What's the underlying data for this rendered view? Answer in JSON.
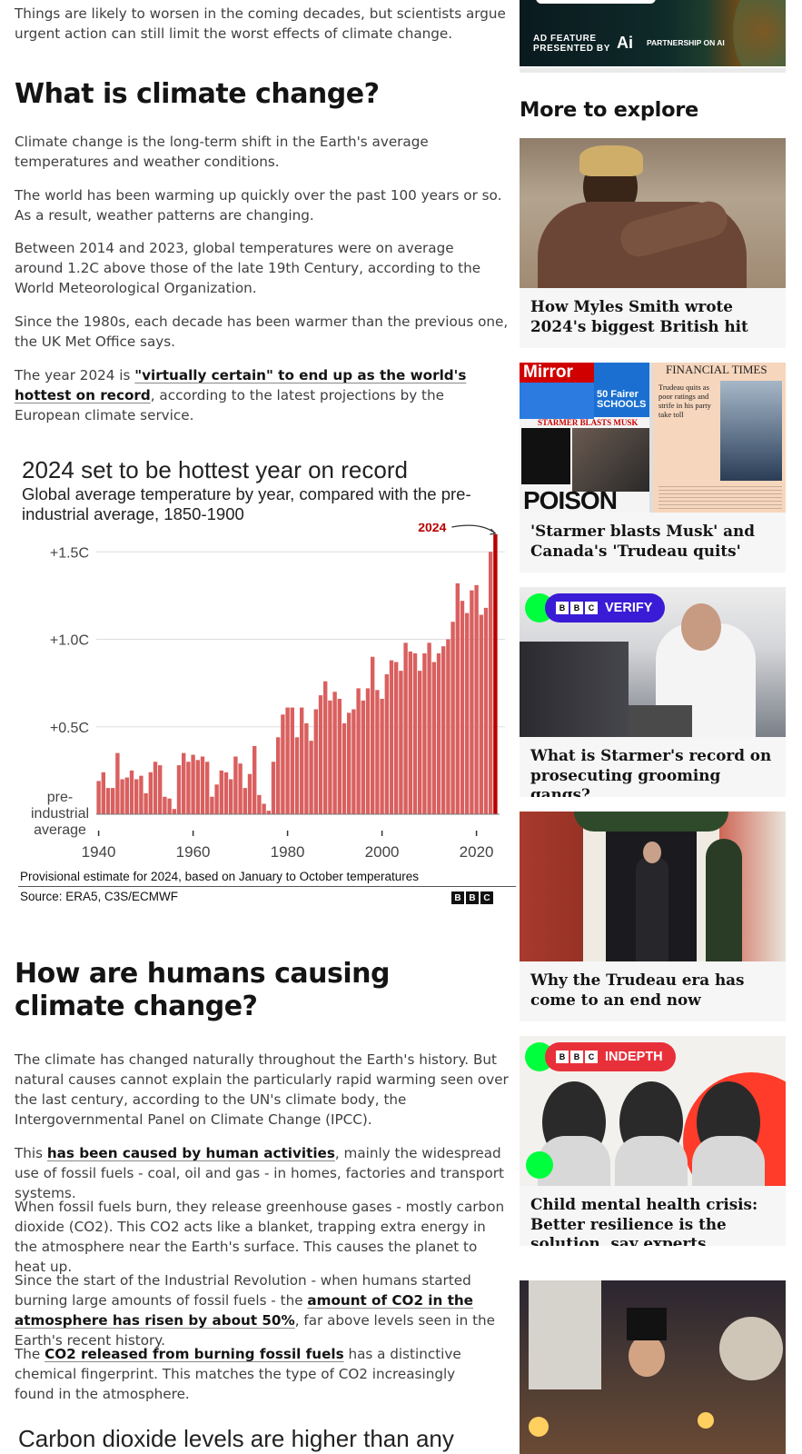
{
  "article": {
    "intro_tail": "Things are likely to worsen in the coming decades, but scientists argue urgent action can still limit the worst effects of climate change.",
    "section1": {
      "heading": "What is climate change?",
      "p1": "Climate change is the long-term shift in the Earth's average temperatures and weather conditions.",
      "p2": "The world has been warming up quickly over the past 100 years or so. As a result, weather patterns are changing.",
      "p3": "Between 2014 and 2023, global temperatures were on average around 1.2C above those of the late 19th Century, according to the World Meteorological Organization.",
      "p4": "Since the 1980s, each decade has been warmer than the previous one, the UK Met Office says.",
      "p5_pre": "The year 2024 is ",
      "p5_link": "\"virtually certain\" to end up as the world's hottest on record",
      "p5_post": ", according to the latest projections by the European climate service."
    },
    "section2": {
      "heading": "How are humans causing climate change?",
      "p1": "The climate has changed naturally throughout the Earth's history. But natural causes cannot explain the particularly rapid warming seen over the last century, according to the UN's climate body, the Intergovernmental Panel on Climate Change (IPCC).",
      "p2_pre": "This ",
      "p2_link": "has been caused by human activities",
      "p2_post": ", mainly the widespread use of fossil fuels - coal, oil and gas - in homes, factories and transport systems.",
      "p3": "When fossil fuels burn, they release greenhouse gases - mostly carbon dioxide (CO2). This CO2 acts like a blanket, trapping extra energy in the atmosphere near the Earth's surface. This causes the planet to heat up.",
      "p4_pre": "Since the start of the Industrial Revolution - when humans started burning large amounts of fossil fuels - the ",
      "p4_link": "amount of CO2 in the atmosphere has risen by about 50%",
      "p4_post": ", far above levels seen in the Earth's recent history.",
      "p5_pre": "The ",
      "p5_link": "CO2 released from burning fossil fuels",
      "p5_post": " has a distinctive chemical fingerprint. This matches the type of CO2 increasingly found in the atmosphere."
    },
    "next_chart_title": "Carbon dioxide levels are higher than any"
  },
  "chart_data": {
    "type": "bar",
    "title": "2024 set to be hottest year on record",
    "subtitle": "Global average temperature by year, compared with the pre-industrial average, 1850-1900",
    "xlabel": "",
    "ylabel": "",
    "x_range": [
      1940,
      2024
    ],
    "x_ticks": [
      "1940",
      "1960",
      "1980",
      "2000",
      "2020"
    ],
    "y_range": [
      0,
      1.6
    ],
    "y_ticks": [
      {
        "value": 0.5,
        "label": "+0.5C"
      },
      {
        "value": 1.0,
        "label": "+1.0C"
      },
      {
        "value": 1.5,
        "label": "+1.5C"
      }
    ],
    "baseline_label": [
      "pre-",
      "industrial",
      "average"
    ],
    "highlight": {
      "year": 2024,
      "label": "2024",
      "color": "#b80000"
    },
    "bar_color": "#d9605f",
    "years": [
      1940,
      1941,
      1942,
      1943,
      1944,
      1945,
      1946,
      1947,
      1948,
      1949,
      1950,
      1951,
      1952,
      1953,
      1954,
      1955,
      1956,
      1957,
      1958,
      1959,
      1960,
      1961,
      1962,
      1963,
      1964,
      1965,
      1966,
      1967,
      1968,
      1969,
      1970,
      1971,
      1972,
      1973,
      1974,
      1975,
      1976,
      1977,
      1978,
      1979,
      1980,
      1981,
      1982,
      1983,
      1984,
      1985,
      1986,
      1987,
      1988,
      1989,
      1990,
      1991,
      1992,
      1993,
      1994,
      1995,
      1996,
      1997,
      1998,
      1999,
      2000,
      2001,
      2002,
      2003,
      2004,
      2005,
      2006,
      2007,
      2008,
      2009,
      2010,
      2011,
      2012,
      2013,
      2014,
      2015,
      2016,
      2017,
      2018,
      2019,
      2020,
      2021,
      2022,
      2023,
      2024
    ],
    "values": [
      0.19,
      0.24,
      0.15,
      0.15,
      0.35,
      0.2,
      0.21,
      0.25,
      0.2,
      0.22,
      0.12,
      0.24,
      0.3,
      0.28,
      0.1,
      0.09,
      0.03,
      0.28,
      0.35,
      0.3,
      0.34,
      0.31,
      0.33,
      0.3,
      0.1,
      0.17,
      0.25,
      0.24,
      0.2,
      0.33,
      0.29,
      0.15,
      0.23,
      0.39,
      0.11,
      0.06,
      0.02,
      0.3,
      0.44,
      0.57,
      0.61,
      0.61,
      0.44,
      0.61,
      0.52,
      0.42,
      0.6,
      0.68,
      0.76,
      0.65,
      0.7,
      0.66,
      0.52,
      0.58,
      0.6,
      0.72,
      0.65,
      0.72,
      0.9,
      0.71,
      0.66,
      0.8,
      0.88,
      0.87,
      0.82,
      0.98,
      0.93,
      0.92,
      0.82,
      0.92,
      0.98,
      0.87,
      0.92,
      0.96,
      1.0,
      1.1,
      1.32,
      1.22,
      1.15,
      1.28,
      1.31,
      1.14,
      1.18,
      1.5,
      1.6
    ],
    "note": "Provisional estimate for 2024, based on January to October temperatures",
    "source": "Source: ERA5, C3S/ECMWF",
    "logo": [
      "B",
      "B",
      "C"
    ]
  },
  "sidebar": {
    "ad": {
      "label_line1": "AD FEATURE",
      "label_line2": "PRESENTED BY",
      "logo_glyph": "Ai",
      "partner": "PARTNERSHIP ON AI"
    },
    "heading": "More to explore",
    "cards": [
      {
        "title": "How Myles Smith wrote 2024's biggest British hit",
        "badge": ""
      },
      {
        "title": "'Starmer blasts Musk' and Canada's 'Trudeau quits'",
        "badge": "",
        "papers": {
          "left_masthead": "Mirror",
          "left_headline": "STARMER BLASTS MUSK",
          "left_bottom": "POISON",
          "left_promo": "50 Fairer SCHOOLS",
          "right_masthead": "FINANCIAL TIMES",
          "right_story": "Trudeau quits as poor ratings and strife in his party take toll"
        }
      },
      {
        "title": "What is Starmer's record on prosecuting grooming gangs?",
        "badge": "VERIFY",
        "badge_color": "#3a1bd6"
      },
      {
        "title": "Why the Trudeau era has come to an end now",
        "badge": ""
      },
      {
        "title": "Child mental health crisis: Better resilience is the solution, say experts",
        "badge": "INDEPTH",
        "badge_color": "#e8303a"
      }
    ],
    "accent_green": "#00ff3c"
  }
}
